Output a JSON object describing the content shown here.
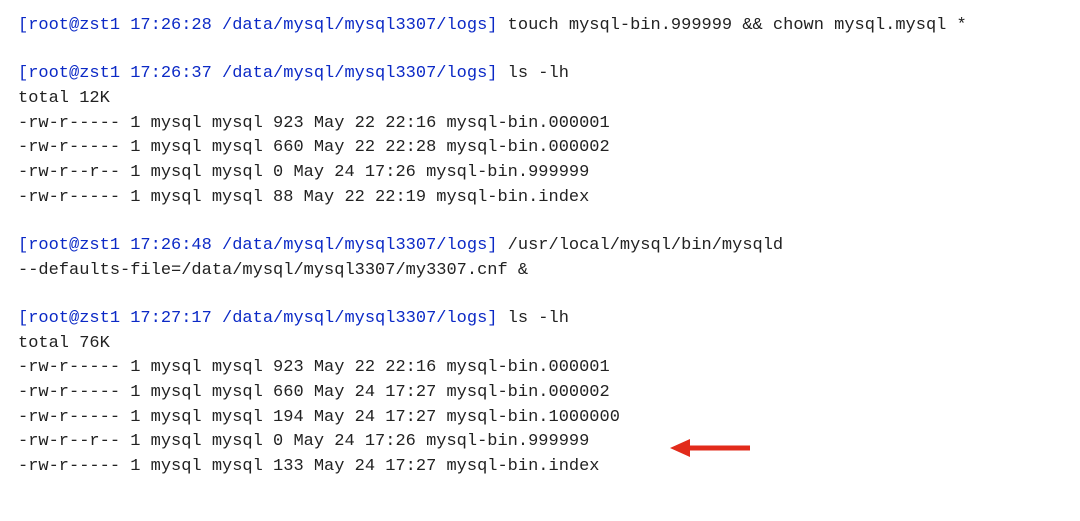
{
  "commands": {
    "cmd1": {
      "prompt": "[root@zst1 17:26:28 /data/mysql/mysql3307/logs]",
      "text": " touch mysql-bin.999999 && chown mysql.mysql *"
    },
    "cmd2": {
      "prompt": "[root@zst1 17:26:37 /data/mysql/mysql3307/logs]",
      "text": " ls -lh"
    },
    "cmd3": {
      "prompt": "[root@zst1 17:26:48 /data/mysql/mysql3307/logs]",
      "text": " /usr/local/mysql/bin/mysqld"
    },
    "cmd3_cont": "--defaults-file=/data/mysql/mysql3307/my3307.cnf &",
    "cmd4": {
      "prompt": "[root@zst1 17:27:17 /data/mysql/mysql3307/logs]",
      "text": " ls -lh"
    }
  },
  "listing1": {
    "total": "total 12K",
    "rows": [
      "-rw-r----- 1 mysql mysql 923 May 22 22:16 mysql-bin.000001",
      "-rw-r----- 1 mysql mysql 660 May 22 22:28 mysql-bin.000002",
      "-rw-r--r-- 1 mysql mysql 0 May 24 17:26 mysql-bin.999999",
      "-rw-r----- 1 mysql mysql 88 May 22 22:19 mysql-bin.index"
    ]
  },
  "listing2": {
    "total": "total 76K",
    "rows": [
      "-rw-r----- 1 mysql mysql 923 May 22 22:16 mysql-bin.000001",
      "-rw-r----- 1 mysql mysql 660 May 24 17:27 mysql-bin.000002",
      "-rw-r----- 1 mysql mysql 194 May 24 17:27 mysql-bin.1000000",
      "-rw-r--r-- 1 mysql mysql 0 May 24 17:26 mysql-bin.999999",
      "-rw-r----- 1 mysql mysql 133 May 24 17:27 mysql-bin.index"
    ]
  },
  "arrow_color": "#e22b1b"
}
